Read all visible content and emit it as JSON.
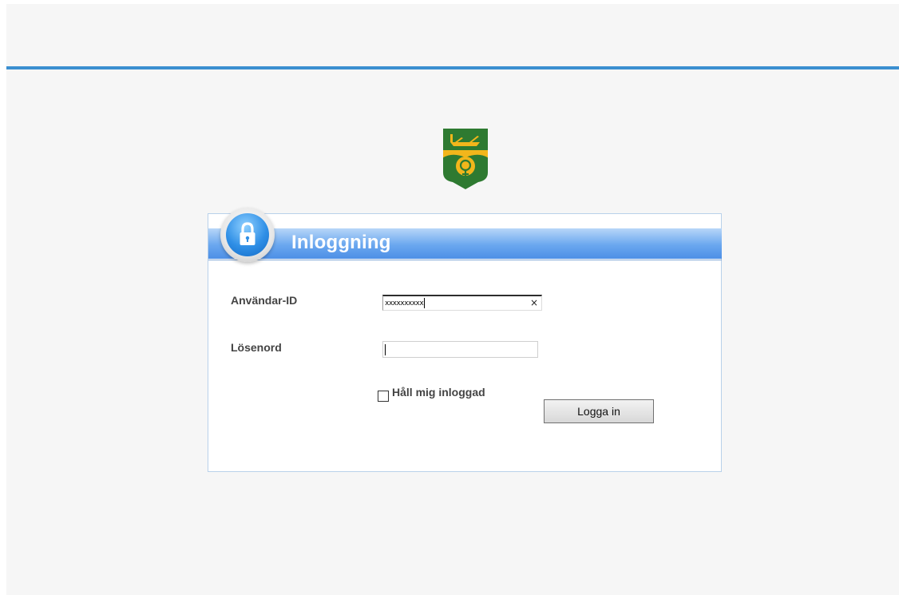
{
  "login": {
    "title": "Inloggning",
    "user_label": "Användar-ID",
    "user_value": "xxxxxxxxxx",
    "clear_symbol": "×",
    "password_label": "Lösenord",
    "password_value": "",
    "remember_label": "Håll mig inloggad",
    "remember_checked": false,
    "login_button": "Logga in"
  },
  "colors": {
    "background": "#f6f6f6",
    "top_line": "#3b8fd0",
    "header_blue": "#4d8fe6",
    "panel_border": "#b9d1ea",
    "coat_of_arms_green": "#2e7a31",
    "coat_of_arms_yellow": "#f2b61b"
  },
  "icons": {
    "logo": "coat-of-arms-icon",
    "lock": "lock-icon"
  }
}
